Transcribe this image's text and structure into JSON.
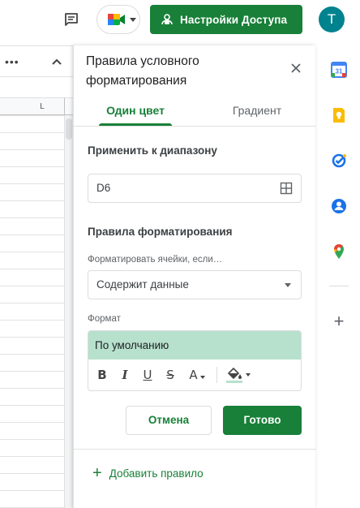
{
  "topbar": {
    "share_label": "Настройки Доступа",
    "avatar_letter": "T"
  },
  "sheet": {
    "column_label": "L"
  },
  "panel": {
    "title": "Правила условного форматирования",
    "tabs": [
      {
        "label": "Один цвет",
        "active": true
      },
      {
        "label": "Градиент",
        "active": false
      }
    ],
    "apply_range_label": "Применить к диапазону",
    "range_value": "D6",
    "rules_label": "Правила форматирования",
    "condition_label": "Форматировать ячейки, если…",
    "condition_value": "Содержит данные",
    "format_label": "Формат",
    "format_preview": "По умолчанию",
    "preview_fill_color": "#b7e1cd",
    "cancel_label": "Отмена",
    "done_label": "Готово",
    "add_rule_label": "Добавить правило"
  },
  "colors": {
    "accent": "#188038",
    "avatar": "#00838f"
  },
  "side_panel": {
    "icons": [
      "calendar-icon",
      "keep-icon",
      "tasks-icon",
      "contacts-icon",
      "maps-icon"
    ],
    "add_icon": "plus-icon"
  }
}
